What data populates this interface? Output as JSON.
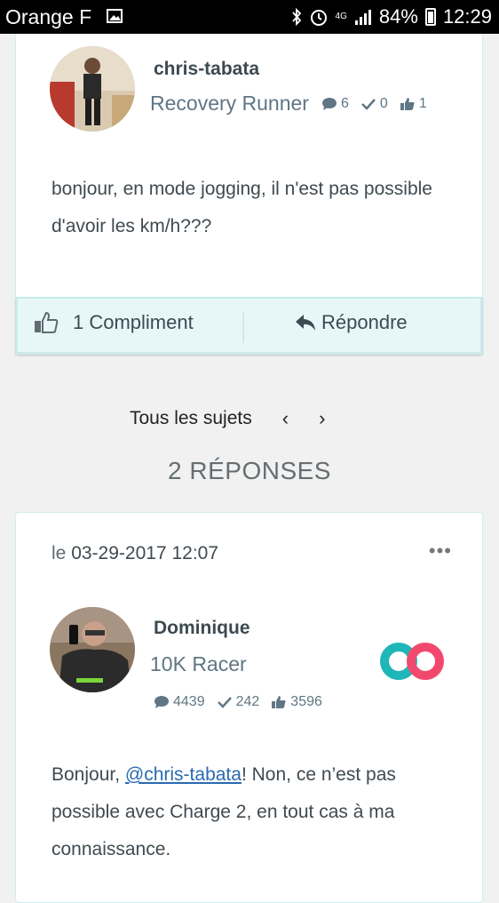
{
  "status_bar": {
    "carrier": "Orange F",
    "network": "4G",
    "battery": "84%",
    "time": "12:29"
  },
  "question_post": {
    "author": "chris-tabata",
    "rank": "Recovery Runner",
    "stats": {
      "messages": "6",
      "solutions": "0",
      "kudos": "1"
    },
    "body": "bonjour, en mode jogging, il n'est pas possible d'avoir les km/h???",
    "compliment_label": "1 Compliment",
    "reply_label": "Répondre"
  },
  "navigation": {
    "all_topics_label": "Tous les sujets",
    "prev_icon": "‹",
    "next_icon": "›"
  },
  "replies_header": "2 RÉPONSES",
  "reply_post": {
    "date_prefix": "le",
    "date": "03-29-2017 12:07",
    "more_label": "•••",
    "author": "Dominique",
    "rank": "10K Racer",
    "stats": {
      "messages": "4439",
      "solutions": "242",
      "kudos": "3596"
    },
    "body_before": "Bonjour, ",
    "mention": "@chris-tabata",
    "body_after": "! Non, ce n’est pas possible avec Charge 2, en tout cas à ma connaissance."
  },
  "colors": {
    "accent_border": "#cfeeee",
    "action_bar_bg": "#e7f7f8",
    "link": "#2a6bb0",
    "badge_teal": "#1fb6b8",
    "badge_pink": "#f2486e"
  }
}
